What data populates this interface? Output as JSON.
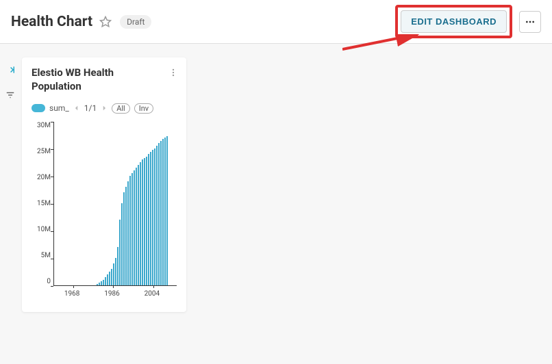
{
  "header": {
    "title": "Health Chart",
    "badge": "Draft",
    "edit_button": "EDIT DASHBOARD"
  },
  "card": {
    "title": "Elestio WB Health Population",
    "series_label": "sum_",
    "page_indicator": "1/1",
    "btn_all": "All",
    "btn_inv": "Inv"
  },
  "chart_data": {
    "type": "bar",
    "title": "Elestio WB Health Population",
    "xlabel": "",
    "ylabel": "",
    "ylim": [
      0,
      30000000
    ],
    "y_ticks": [
      "30M",
      "25M",
      "20M",
      "15M",
      "10M",
      "5M",
      "0"
    ],
    "x_ticks": [
      "1968",
      "1986",
      "2004"
    ],
    "x_range": [
      1960,
      2014
    ],
    "series": [
      {
        "name": "sum_",
        "color": "#3ca8cc",
        "x": [
          1960,
          1961,
          1962,
          1963,
          1964,
          1965,
          1966,
          1967,
          1968,
          1969,
          1970,
          1971,
          1972,
          1973,
          1974,
          1975,
          1976,
          1977,
          1978,
          1979,
          1980,
          1981,
          1982,
          1983,
          1984,
          1985,
          1986,
          1987,
          1988,
          1989,
          1990,
          1991,
          1992,
          1993,
          1994,
          1995,
          1996,
          1997,
          1998,
          1999,
          2000,
          2001,
          2002,
          2003,
          2004,
          2005,
          2006,
          2007,
          2008,
          2009,
          2010,
          2011,
          2012,
          2013,
          2014
        ],
        "values": [
          0,
          0,
          0,
          0,
          0,
          0,
          0,
          0,
          0,
          0,
          0,
          0,
          0,
          0,
          0,
          0,
          0,
          0,
          0,
          0,
          200000,
          400000,
          700000,
          1000000,
          1500000,
          2000000,
          2500000,
          3000000,
          4000000,
          5000000,
          7000000,
          12000000,
          15000000,
          17000000,
          18000000,
          19000000,
          20000000,
          20500000,
          21000000,
          21500000,
          22000000,
          22500000,
          23000000,
          23200000,
          23500000,
          24000000,
          24300000,
          24700000,
          25000000,
          25500000,
          26000000,
          26300000,
          26700000,
          27000000,
          27200000
        ]
      }
    ]
  }
}
